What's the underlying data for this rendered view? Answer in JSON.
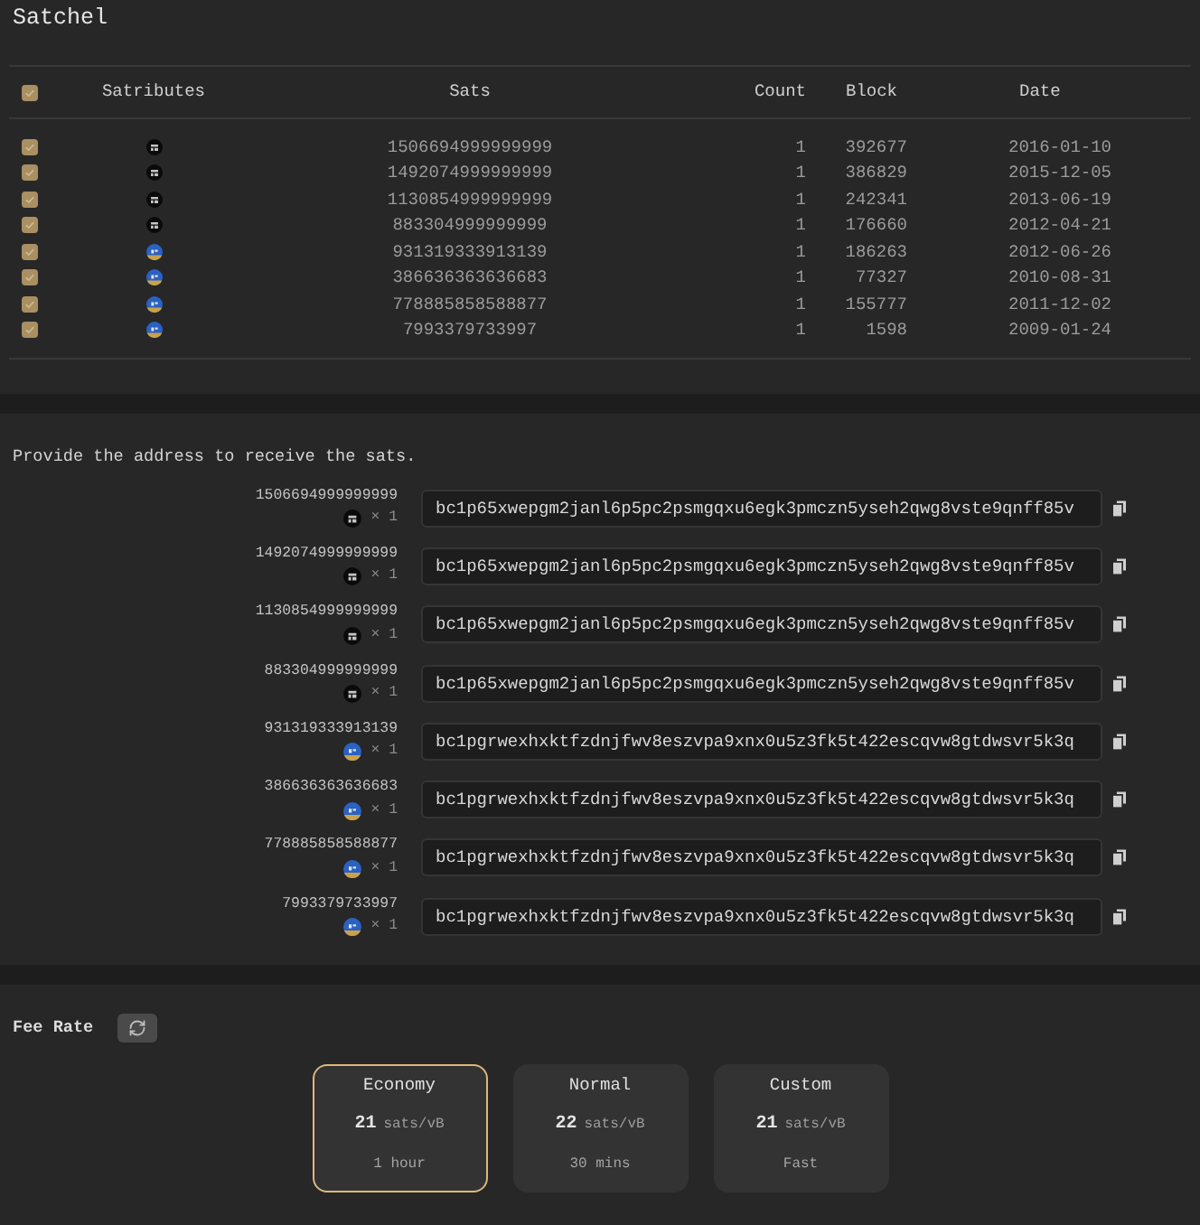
{
  "title": "Satchel",
  "table": {
    "select_all": {
      "checked": true
    },
    "columns": [
      "Satributes",
      "Sats",
      "Count",
      "Block",
      "Date"
    ],
    "rows": [
      {
        "checked": true,
        "satribute": {
          "kind": "black"
        },
        "sats": "1506694999999999",
        "count": "1",
        "block": "392677",
        "date": "2016-01-10"
      },
      {
        "checked": true,
        "satribute": {
          "kind": "black"
        },
        "sats": "1492074999999999",
        "count": "1",
        "block": "386829",
        "date": "2015-12-05"
      },
      {
        "checked": true,
        "satribute": {
          "kind": "black"
        },
        "sats": "1130854999999999",
        "count": "1",
        "block": "242341",
        "date": "2013-06-19"
      },
      {
        "checked": true,
        "satribute": {
          "kind": "black"
        },
        "sats": "883304999999999",
        "count": "1",
        "block": "176660",
        "date": "2012-04-21"
      },
      {
        "checked": true,
        "satribute": {
          "kind": "palindrome"
        },
        "sats": "931319333913139",
        "count": "1",
        "block": "186263",
        "date": "2012-06-26"
      },
      {
        "checked": true,
        "satribute": {
          "kind": "palindrome"
        },
        "sats": "386636363636683",
        "count": "1",
        "block": "77327",
        "date": "2010-08-31"
      },
      {
        "checked": true,
        "satribute": {
          "kind": "palindrome"
        },
        "sats": "778885858588877",
        "count": "1",
        "block": "155777",
        "date": "2011-12-02"
      },
      {
        "checked": true,
        "satribute": {
          "kind": "palindrome"
        },
        "sats": "7993379733997",
        "count": "1",
        "block": "1598",
        "date": "2009-01-24"
      }
    ]
  },
  "address_section": {
    "prompt": "Provide the address to receive the sats.",
    "rows": [
      {
        "sats": "1506694999999999",
        "satribute": {
          "kind": "black"
        },
        "quantity": "× 1",
        "address": "bc1p65xwepgm2janl6p5pc2psmgqxu6egk3pmczn5yseh2qwg8vste9qnff85v"
      },
      {
        "sats": "1492074999999999",
        "satribute": {
          "kind": "black"
        },
        "quantity": "× 1",
        "address": "bc1p65xwepgm2janl6p5pc2psmgqxu6egk3pmczn5yseh2qwg8vste9qnff85v"
      },
      {
        "sats": "1130854999999999",
        "satribute": {
          "kind": "black"
        },
        "quantity": "× 1",
        "address": "bc1p65xwepgm2janl6p5pc2psmgqxu6egk3pmczn5yseh2qwg8vste9qnff85v"
      },
      {
        "sats": "883304999999999",
        "satribute": {
          "kind": "black"
        },
        "quantity": "× 1",
        "address": "bc1p65xwepgm2janl6p5pc2psmgqxu6egk3pmczn5yseh2qwg8vste9qnff85v"
      },
      {
        "sats": "931319333913139",
        "satribute": {
          "kind": "palindrome"
        },
        "quantity": "× 1",
        "address": "bc1pgrwexhxktfzdnjfwv8eszvpa9xnx0u5z3fk5t422escqvw8gtdwsvr5k3q"
      },
      {
        "sats": "386636363636683",
        "satribute": {
          "kind": "palindrome"
        },
        "quantity": "× 1",
        "address": "bc1pgrwexhxktfzdnjfwv8eszvpa9xnx0u5z3fk5t422escqvw8gtdwsvr5k3q"
      },
      {
        "sats": "778885858588877",
        "satribute": {
          "kind": "palindrome"
        },
        "quantity": "× 1",
        "address": "bc1pgrwexhxktfzdnjfwv8eszvpa9xnx0u5z3fk5t422escqvw8gtdwsvr5k3q"
      },
      {
        "sats": "7993379733997",
        "satribute": {
          "kind": "palindrome"
        },
        "quantity": "× 1",
        "address": "bc1pgrwexhxktfzdnjfwv8eszvpa9xnx0u5z3fk5t422escqvw8gtdwsvr5k3q"
      }
    ]
  },
  "fee_rate": {
    "label": "Fee Rate",
    "options": [
      {
        "name": "Economy",
        "rate": "21",
        "unit": "sats/vB",
        "time": "1 hour",
        "selected": true
      },
      {
        "name": "Normal",
        "rate": "22",
        "unit": "sats/vB",
        "time": "30 mins",
        "selected": false
      },
      {
        "name": "Custom",
        "rate": "21",
        "unit": "sats/vB",
        "time": "Fast",
        "selected": false
      }
    ]
  }
}
